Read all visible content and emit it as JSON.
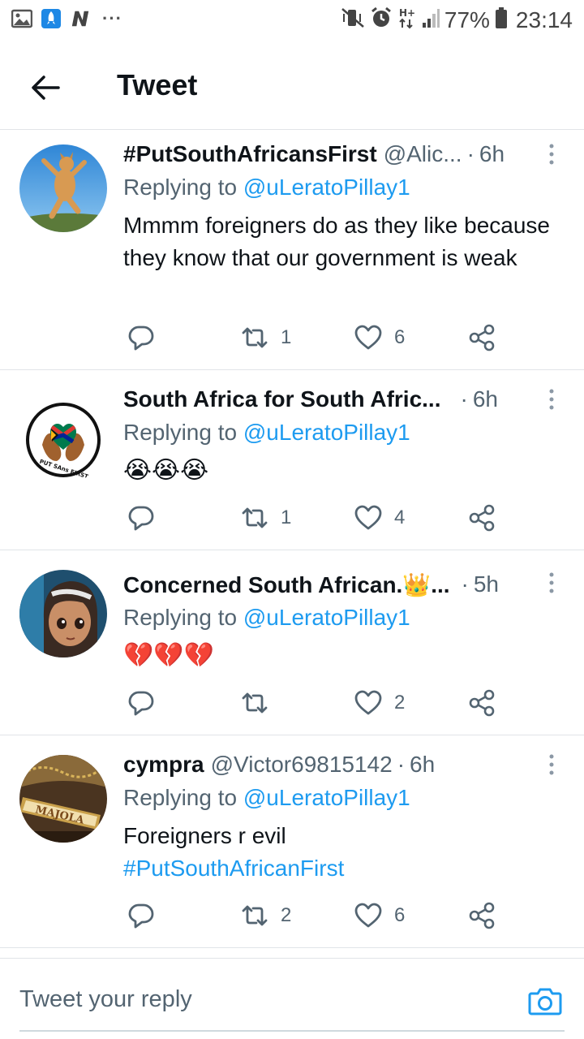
{
  "status_bar": {
    "left_icons": [
      "gallery-icon",
      "rocket-app-icon",
      "n-app-icon"
    ],
    "more": "···",
    "battery_percent": "77%",
    "time": "23:14",
    "network": "H+"
  },
  "header": {
    "title": "Tweet",
    "back_icon": "arrow-left-icon"
  },
  "tweets": [
    {
      "name": "#PutSouthAfricansFirst",
      "handle": "@Alic...",
      "separator": "·",
      "time": "6h",
      "reply_prefix": "Replying to",
      "reply_to": "@uLeratoPillay1",
      "text": "Mmmm foreigners do as they like because they know that our government is weak",
      "replies": "",
      "retweets": "1",
      "likes": "6"
    },
    {
      "name": "South Africa for South Afric...",
      "separator": "·",
      "time": "6h",
      "reply_prefix": "Replying to",
      "reply_to": "@uLeratoPillay1",
      "text": "😭😭😭",
      "avatar_text": "PUT SAns FIRST",
      "replies": "",
      "retweets": "1",
      "likes": "4"
    },
    {
      "name": "Concerned South African.👑...",
      "separator": "·",
      "time": "5h",
      "reply_prefix": "Replying to",
      "reply_to": "@uLeratoPillay1",
      "text": "💔💔💔",
      "replies": "",
      "retweets": "",
      "likes": "2"
    },
    {
      "name": "cympra",
      "handle": "@Victor69815142",
      "separator": "·",
      "time": "6h",
      "reply_prefix": "Replying to",
      "reply_to": "@uLeratoPillay1",
      "text": "Foreigners r evil",
      "hashtag": "#PutSouthAfricanFirst",
      "avatar_text": "MAJOLA",
      "replies": "",
      "retweets": "2",
      "likes": "6"
    }
  ],
  "reply_bar": {
    "placeholder": "Tweet your reply",
    "camera_icon": "camera-icon"
  },
  "colors": {
    "accent": "#1d9bf0",
    "secondary_text": "#536471",
    "divider": "#e1e4e8"
  }
}
